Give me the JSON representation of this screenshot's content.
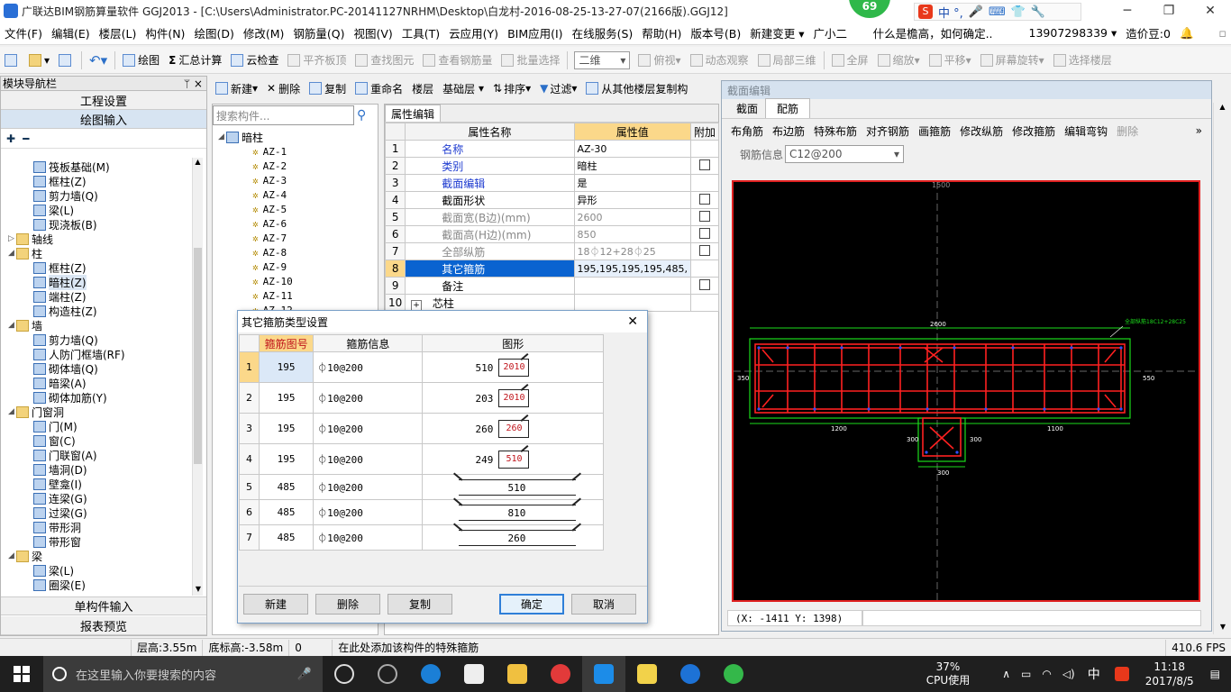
{
  "window": {
    "title": "广联达BIM钢筋算量软件 GGJ2013 - [C:\\Users\\Administrator.PC-20141127NRHM\\Desktop\\白龙村-2016-08-25-13-27-07(2166版).GGJ12]",
    "badge": "69"
  },
  "menu": [
    "文件(F)",
    "编辑(E)",
    "楼层(L)",
    "构件(N)",
    "绘图(D)",
    "修改(M)",
    "钢筋量(Q)",
    "视图(V)",
    "工具(T)",
    "云应用(Y)",
    "BIM应用(I)",
    "在线服务(S)",
    "帮助(H)",
    "版本号(B)",
    "新建变更 ▾",
    "广小二",
    "什么是檐高，如何确定..",
    "13907298339 ▾",
    "造价豆:0"
  ],
  "toolbar": {
    "draw": "绘图",
    "sum": "汇总计算",
    "cloud_check": "云检查",
    "flat_top": "平齐板顶",
    "find": "查找图元",
    "view_steel": "查看钢筋量",
    "batch": "批量选择",
    "view_mode": "二维",
    "items2": [
      "俯视",
      "动态观察",
      "局部三维",
      "全屏",
      "缩放",
      "平移",
      "屏幕旋转",
      "选择楼层"
    ]
  },
  "toolbar2": {
    "new": "新建",
    "delete": "删除",
    "copy": "复制",
    "rename": "重命名",
    "floor_lbl": "楼层",
    "floor": "基础层",
    "sort": "排序",
    "filter": "过滤",
    "copy_from": "从其他楼层复制构"
  },
  "left_panel": {
    "header": "模块导航栏",
    "pin": "ᛘ ×",
    "btn_project": "工程设置",
    "btn_draw": "绘图输入",
    "btn_single": "单构件输入",
    "btn_report": "报表预览",
    "tree": [
      {
        "lvl": 2,
        "t": "筏板基础(M)"
      },
      {
        "lvl": 2,
        "t": "框柱(Z)"
      },
      {
        "lvl": 2,
        "t": "剪力墙(Q)"
      },
      {
        "lvl": 2,
        "t": "梁(L)"
      },
      {
        "lvl": 2,
        "t": "现浇板(B)"
      },
      {
        "lvl": 1,
        "t": "轴线",
        "tg": "▷",
        "folder": true
      },
      {
        "lvl": 1,
        "t": "柱",
        "tg": "◢",
        "folder": true
      },
      {
        "lvl": 2,
        "t": "框柱(Z)"
      },
      {
        "lvl": 2,
        "t": "暗柱(Z)",
        "sel": true
      },
      {
        "lvl": 2,
        "t": "端柱(Z)"
      },
      {
        "lvl": 2,
        "t": "构造柱(Z)"
      },
      {
        "lvl": 1,
        "t": "墙",
        "tg": "◢",
        "folder": true
      },
      {
        "lvl": 2,
        "t": "剪力墙(Q)"
      },
      {
        "lvl": 2,
        "t": "人防门框墙(RF)"
      },
      {
        "lvl": 2,
        "t": "砌体墙(Q)"
      },
      {
        "lvl": 2,
        "t": "暗梁(A)"
      },
      {
        "lvl": 2,
        "t": "砌体加筋(Y)"
      },
      {
        "lvl": 1,
        "t": "门窗洞",
        "tg": "◢",
        "folder": true
      },
      {
        "lvl": 2,
        "t": "门(M)"
      },
      {
        "lvl": 2,
        "t": "窗(C)"
      },
      {
        "lvl": 2,
        "t": "门联窗(A)"
      },
      {
        "lvl": 2,
        "t": "墙洞(D)"
      },
      {
        "lvl": 2,
        "t": "壁龛(I)"
      },
      {
        "lvl": 2,
        "t": "连梁(G)"
      },
      {
        "lvl": 2,
        "t": "过梁(G)"
      },
      {
        "lvl": 2,
        "t": "带形洞"
      },
      {
        "lvl": 2,
        "t": "带形窗"
      },
      {
        "lvl": 1,
        "t": "梁",
        "tg": "◢",
        "folder": true
      },
      {
        "lvl": 2,
        "t": "梁(L)"
      },
      {
        "lvl": 2,
        "t": "圈梁(E)"
      }
    ]
  },
  "component_tree": {
    "search_placeholder": "搜索构件...",
    "root": "暗柱",
    "items": [
      "AZ-1",
      "AZ-2",
      "AZ-3",
      "AZ-4",
      "AZ-5",
      "AZ-6",
      "AZ-7",
      "AZ-8",
      "AZ-9",
      "AZ-10",
      "AZ-11",
      "AZ-12"
    ]
  },
  "properties": {
    "tab": "属性编辑",
    "headers": [
      "属性名称",
      "属性值",
      "附加"
    ],
    "rows": [
      {
        "n": "1",
        "name": "名称",
        "val": "AZ-30",
        "style": "blue",
        "chk": false
      },
      {
        "n": "2",
        "name": "类别",
        "val": "暗柱",
        "style": "blue",
        "chk": true
      },
      {
        "n": "3",
        "name": "截面编辑",
        "val": "是",
        "style": "blue",
        "chk": false
      },
      {
        "n": "4",
        "name": "截面形状",
        "val": "异形",
        "style": "",
        "chk": true
      },
      {
        "n": "5",
        "name": "截面宽(B边)(mm)",
        "val": "2600",
        "style": "grey",
        "chk": true
      },
      {
        "n": "6",
        "name": "截面高(H边)(mm)",
        "val": "850",
        "style": "grey",
        "chk": true
      },
      {
        "n": "7",
        "name": "全部纵筋",
        "val": "18⏀12+28⏀25",
        "style": "grey",
        "chk": true
      },
      {
        "n": "8",
        "name": "其它箍筋",
        "val": "195,195,195,195,485,",
        "style": "sel",
        "chk": false
      },
      {
        "n": "9",
        "name": "备注",
        "val": "",
        "style": "",
        "chk": true
      },
      {
        "n": "10",
        "name": "芯柱",
        "val": "",
        "style": "",
        "chk": false
      }
    ]
  },
  "section_panel": {
    "title": "截面编辑",
    "tabs": [
      "截面",
      "配筋"
    ],
    "tools": [
      "布角筋",
      "布边筋",
      "特殊布筋",
      "对齐钢筋",
      "画箍筋",
      "修改纵筋",
      "修改箍筋",
      "编辑弯钩",
      "删除"
    ],
    "steel_info_label": "钢筋信息",
    "steel_info_value": "C12@200",
    "coords": "(X: -1411 Y: 1398)",
    "dims": {
      "top": "2600",
      "left_h": "350",
      "right_h": "550",
      "b1": "1200",
      "b2": "300",
      "b3": "300",
      "b4": "1100",
      "bottom": "300",
      "axis": "1500",
      "note": "全部纵筋18C12+28C25"
    }
  },
  "dialog": {
    "title": "其它箍筋类型设置",
    "headers": [
      "箍筋图号",
      "箍筋信息",
      "图形"
    ],
    "rows": [
      {
        "n": "1",
        "code": "195",
        "info": "⏀10@200",
        "a": "510",
        "b": "2010",
        "shape": "hook"
      },
      {
        "n": "2",
        "code": "195",
        "info": "⏀10@200",
        "a": "203",
        "b": "2010",
        "shape": "hook"
      },
      {
        "n": "3",
        "code": "195",
        "info": "⏀10@200",
        "a": "260",
        "b": "260",
        "shape": "hook"
      },
      {
        "n": "4",
        "code": "195",
        "info": "⏀10@200",
        "a": "249",
        "b": "510",
        "shape": "hook"
      },
      {
        "n": "5",
        "code": "485",
        "info": "⏀10@200",
        "a": "510",
        "shape": "bar"
      },
      {
        "n": "6",
        "code": "485",
        "info": "⏀10@200",
        "a": "810",
        "shape": "bar"
      },
      {
        "n": "7",
        "code": "485",
        "info": "⏀10@200",
        "a": "260",
        "shape": "bar"
      }
    ],
    "btn_new": "新建",
    "btn_delete": "删除",
    "btn_copy": "复制",
    "btn_ok": "确定",
    "btn_cancel": "取消"
  },
  "statusbar": {
    "floor_h": "层高:3.55m",
    "bottom_h": "底标高:-3.58m",
    "zero": "0",
    "hint": "在此处添加该构件的特殊箍筋",
    "fps": "410.6 FPS"
  },
  "taskbar": {
    "search": "在这里输入你要搜索的内容",
    "cpu": "37%",
    "cpu_label": "CPU使用",
    "ime": "中",
    "time": "11:18",
    "date": "2017/8/5"
  }
}
